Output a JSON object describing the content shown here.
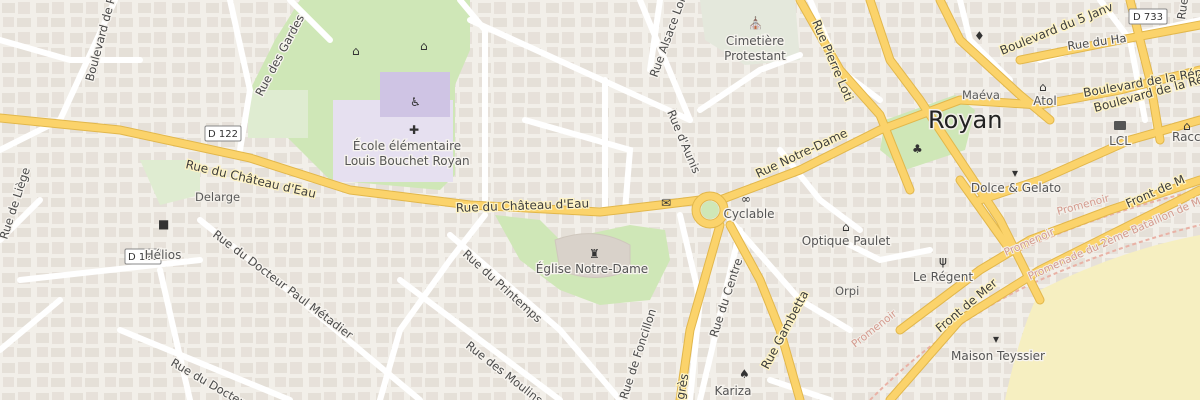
{
  "map": {
    "city": "Royan",
    "colors": {
      "background": "#f2efe9",
      "park": "#cfe7b7",
      "school": "#e6e0f0",
      "building": "#e2dcd4",
      "beach": "#f6efc1",
      "major_road": "#fbd36b",
      "major_road_casing": "#e2b74b",
      "minor_road": "#ffffff",
      "promenade": "#e9b2a6"
    },
    "streets": [
      "Rue du Château d'Eau",
      "Rue du Château d'Eau",
      "Rue Notre-Dame",
      "Rue Pierre Loti",
      "Rue Alsace Lorraine",
      "Rue d'Aunis",
      "Rue des Gardes",
      "Boulevard de Pe",
      "Rue de Liège",
      "Rue du Docteur Paul Métadier",
      "Rue du Docteur N",
      "Rue du Printemps",
      "Rue des Moulins",
      "Rue de Foncillon",
      "Rue du Centre",
      "Rue Gambetta",
      "Front de Mer",
      "Front de M",
      "Boulevard du 5 Janv",
      "Boulevard de la Répub",
      "Boulevard de la Rép",
      "Promenade du 2ème Bataillon de Ma",
      "Rue du Ha",
      "Rue d",
      "grès"
    ],
    "promenoir_labels": [
      "Promenoir",
      "Promenoir",
      "Promenoir"
    ],
    "road_shields": [
      "D 122",
      "D 122",
      "D 733"
    ],
    "pois": [
      {
        "label": "Cimetière Protestant",
        "line1": "Cimetière",
        "line2": "Protestant",
        "icon": "cemetery-icon"
      },
      {
        "label": "École élémentaire Louis Bouchet Royan",
        "line1": "École élémentaire",
        "line2": "Louis Bouchet Royan",
        "icon": "school-icon"
      },
      {
        "label": "Église Notre-Dame",
        "icon": "church-icon"
      },
      {
        "label": "Delarge",
        "icon": ""
      },
      {
        "label": "Hélios",
        "icon": "bus-stop-icon"
      },
      {
        "label": "Cyclable",
        "icon": "bicycle-icon"
      },
      {
        "label": "Optique Paulet",
        "icon": "shop-icon"
      },
      {
        "label": "Orpi",
        "icon": ""
      },
      {
        "label": "Le Régent",
        "icon": "restaurant-icon"
      },
      {
        "label": "Maison Teyssier",
        "icon": "ice-cream-icon"
      },
      {
        "label": "Dolce & Gelato",
        "icon": "ice-cream-icon"
      },
      {
        "label": "Kariza",
        "icon": "clothes-icon"
      },
      {
        "label": "LCL",
        "icon": "bank-icon"
      },
      {
        "label": "Racco",
        "icon": "shop-icon"
      },
      {
        "label": "Atol",
        "icon": "shop-icon"
      },
      {
        "label": "Maéva",
        "icon": ""
      }
    ]
  }
}
